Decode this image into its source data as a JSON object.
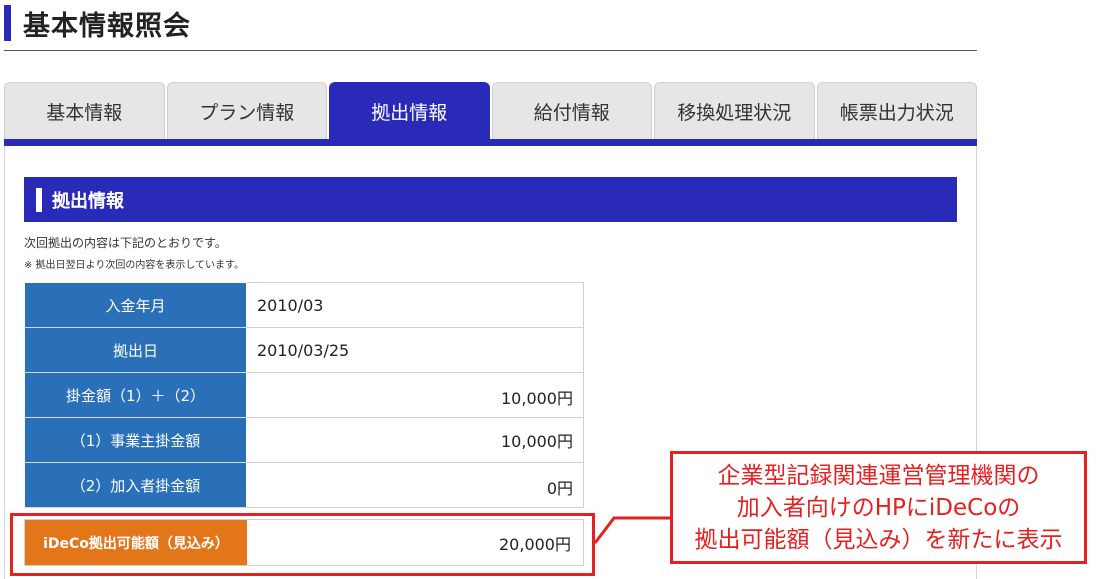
{
  "page": {
    "title": "基本情報照会"
  },
  "tabs": [
    {
      "label": "基本情報"
    },
    {
      "label": "プラン情報"
    },
    {
      "label": "拠出情報"
    },
    {
      "label": "給付情報"
    },
    {
      "label": "移換処理状況"
    },
    {
      "label": "帳票出力状況"
    }
  ],
  "active_tab": "拠出情報",
  "section": {
    "title": "拠出情報",
    "description": "次回拠出の内容は下記のとおりです。",
    "note": "※ 拠出日翌日より次回の内容を表示しています。"
  },
  "table": {
    "rows": [
      {
        "label": "入金年月",
        "value": "2010/03"
      },
      {
        "label": "拠出日",
        "value": "2010/03/25"
      },
      {
        "label": "掛金額（1）＋（2）",
        "value": "10,000円"
      },
      {
        "label": "（1）事業主掛金額",
        "value": "10,000円"
      },
      {
        "label": "（2）加入者掛金額",
        "value": "0円"
      }
    ]
  },
  "ideco": {
    "label": "iDeCo拠出可能額（見込み）",
    "value": "20,000円"
  },
  "callout": {
    "line1": "企業型記録関連運営管理機関の",
    "line2": "加入者向けのHPにiDeCoの",
    "line3": "拠出可能額（見込み）を新たに表示"
  },
  "colors": {
    "primary": "#2a2ab8",
    "table_header": "#2a70b8",
    "ideco_label": "#e4761a",
    "highlight": "#e52020"
  }
}
